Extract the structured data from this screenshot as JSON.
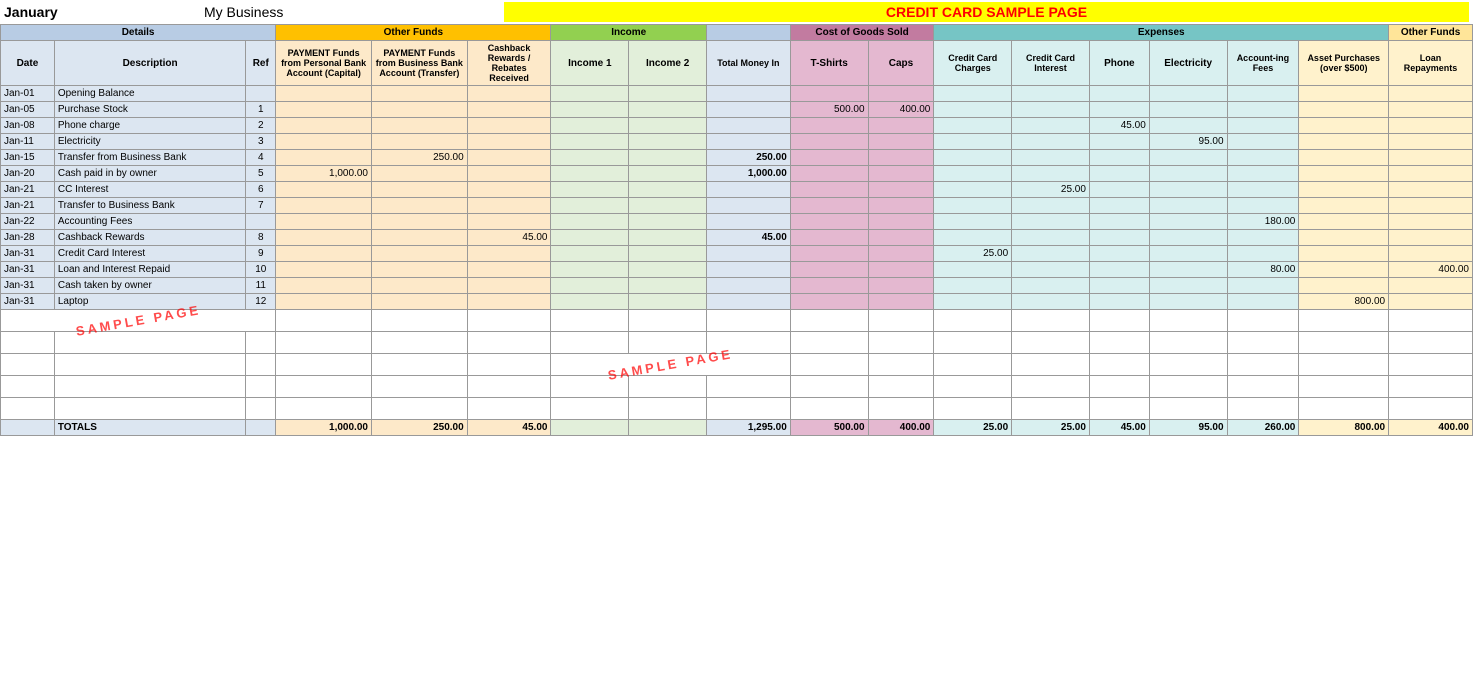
{
  "header": {
    "month": "January",
    "business": "My Business",
    "title": "CREDIT CARD SAMPLE PAGE"
  },
  "columns": {
    "group1_label": "Details",
    "group2_label": "Other Funds",
    "group3_label": "Income",
    "group4_label": "Cost of Goods Sold",
    "group5_label": "Expenses",
    "group6_label": "Other Funds"
  },
  "subheaders": {
    "date": "Date",
    "description": "Description",
    "ref": "Ref",
    "payment_personal": "PAYMENT Funds from Personal Bank Account (Capital)",
    "payment_business": "PAYMENT Funds from Business Bank Account (Transfer)",
    "cashback": "Cashback Rewards / Rebates Received",
    "income1": "Income 1",
    "income2": "Income 2",
    "total_money_in": "Total Money In",
    "tshirts": "T-Shirts",
    "caps": "Caps",
    "credit_card_charges": "Credit Card Charges",
    "credit_card_interest": "Credit Card Interest",
    "phone": "Phone",
    "electricity": "Electricity",
    "accounting_fees": "Account-ing Fees",
    "asset_purchases": "Asset Purchases (over $500)",
    "loan_repayments": "Loan Repayments"
  },
  "rows": [
    {
      "date": "Jan-01",
      "description": "Opening Balance",
      "ref": "",
      "payment_personal": "",
      "payment_business": "",
      "cashback": "",
      "income1": "",
      "income2": "",
      "total_money_in": "",
      "tshirts": "",
      "caps": "",
      "cc_charges": "",
      "cc_interest": "",
      "phone": "",
      "electricity": "",
      "accounting": "",
      "asset": "",
      "loan": ""
    },
    {
      "date": "Jan-05",
      "description": "Purchase Stock",
      "ref": "1",
      "payment_personal": "",
      "payment_business": "",
      "cashback": "",
      "income1": "",
      "income2": "",
      "total_money_in": "",
      "tshirts": "500.00",
      "caps": "400.00",
      "cc_charges": "",
      "cc_interest": "",
      "phone": "",
      "electricity": "",
      "accounting": "",
      "asset": "",
      "loan": ""
    },
    {
      "date": "Jan-08",
      "description": "Phone charge",
      "ref": "2",
      "payment_personal": "",
      "payment_business": "",
      "cashback": "",
      "income1": "",
      "income2": "",
      "total_money_in": "",
      "tshirts": "",
      "caps": "",
      "cc_charges": "",
      "cc_interest": "",
      "phone": "45.00",
      "electricity": "",
      "accounting": "",
      "asset": "",
      "loan": ""
    },
    {
      "date": "Jan-11",
      "description": "Electricity",
      "ref": "3",
      "payment_personal": "",
      "payment_business": "",
      "cashback": "",
      "income1": "",
      "income2": "",
      "total_money_in": "",
      "tshirts": "",
      "caps": "",
      "cc_charges": "",
      "cc_interest": "",
      "phone": "",
      "electricity": "95.00",
      "accounting": "",
      "asset": "",
      "loan": ""
    },
    {
      "date": "Jan-15",
      "description": "Transfer from Business Bank",
      "ref": "4",
      "payment_personal": "",
      "payment_business": "250.00",
      "cashback": "",
      "income1": "",
      "income2": "",
      "total_money_in": "250.00",
      "tshirts": "",
      "caps": "",
      "cc_charges": "",
      "cc_interest": "",
      "phone": "",
      "electricity": "",
      "accounting": "",
      "asset": "",
      "loan": ""
    },
    {
      "date": "Jan-20",
      "description": "Cash paid in by owner",
      "ref": "5",
      "payment_personal": "1,000.00",
      "payment_business": "",
      "cashback": "",
      "income1": "",
      "income2": "",
      "total_money_in": "1,000.00",
      "tshirts": "",
      "caps": "",
      "cc_charges": "",
      "cc_interest": "",
      "phone": "",
      "electricity": "",
      "accounting": "",
      "asset": "",
      "loan": ""
    },
    {
      "date": "Jan-21",
      "description": "CC Interest",
      "ref": "6",
      "payment_personal": "",
      "payment_business": "",
      "cashback": "",
      "income1": "",
      "income2": "",
      "total_money_in": "",
      "tshirts": "",
      "caps": "",
      "cc_charges": "",
      "cc_interest": "25.00",
      "phone": "",
      "electricity": "",
      "accounting": "",
      "asset": "",
      "loan": ""
    },
    {
      "date": "Jan-21",
      "description": "Transfer to Business Bank",
      "ref": "7",
      "payment_personal": "",
      "payment_business": "",
      "cashback": "",
      "income1": "",
      "income2": "",
      "total_money_in": "",
      "tshirts": "",
      "caps": "",
      "cc_charges": "",
      "cc_interest": "",
      "phone": "",
      "electricity": "",
      "accounting": "",
      "asset": "",
      "loan": ""
    },
    {
      "date": "Jan-22",
      "description": "Accounting Fees",
      "ref": "",
      "payment_personal": "",
      "payment_business": "",
      "cashback": "",
      "income1": "",
      "income2": "",
      "total_money_in": "",
      "tshirts": "",
      "caps": "",
      "cc_charges": "",
      "cc_interest": "",
      "phone": "",
      "electricity": "",
      "accounting": "180.00",
      "asset": "",
      "loan": ""
    },
    {
      "date": "Jan-28",
      "description": "Cashback Rewards",
      "ref": "8",
      "payment_personal": "",
      "payment_business": "",
      "cashback": "45.00",
      "income1": "",
      "income2": "",
      "total_money_in": "45.00",
      "tshirts": "",
      "caps": "",
      "cc_charges": "",
      "cc_interest": "",
      "phone": "",
      "electricity": "",
      "accounting": "",
      "asset": "",
      "loan": ""
    },
    {
      "date": "Jan-31",
      "description": "Credit Card Interest",
      "ref": "9",
      "payment_personal": "",
      "payment_business": "",
      "cashback": "",
      "income1": "",
      "income2": "",
      "total_money_in": "",
      "tshirts": "",
      "caps": "",
      "cc_charges": "25.00",
      "cc_interest": "",
      "phone": "",
      "electricity": "",
      "accounting": "",
      "asset": "",
      "loan": ""
    },
    {
      "date": "Jan-31",
      "description": "Loan and Interest Repaid",
      "ref": "10",
      "payment_personal": "",
      "payment_business": "",
      "cashback": "",
      "income1": "",
      "income2": "",
      "total_money_in": "",
      "tshirts": "",
      "caps": "",
      "cc_charges": "",
      "cc_interest": "",
      "phone": "",
      "electricity": "",
      "accounting": "80.00",
      "asset": "",
      "loan": "400.00"
    },
    {
      "date": "Jan-31",
      "description": "Cash taken by owner",
      "ref": "11",
      "payment_personal": "",
      "payment_business": "",
      "cashback": "",
      "income1": "",
      "income2": "",
      "total_money_in": "",
      "tshirts": "",
      "caps": "",
      "cc_charges": "",
      "cc_interest": "",
      "phone": "",
      "electricity": "",
      "accounting": "",
      "asset": "",
      "loan": ""
    },
    {
      "date": "Jan-31",
      "description": "Laptop",
      "ref": "12",
      "payment_personal": "",
      "payment_business": "",
      "cashback": "",
      "income1": "",
      "income2": "",
      "total_money_in": "",
      "tshirts": "",
      "caps": "",
      "cc_charges": "",
      "cc_interest": "",
      "phone": "",
      "electricity": "",
      "accounting": "",
      "asset": "800.00",
      "loan": ""
    }
  ],
  "sample_rows": [
    {
      "has_sample1": true,
      "has_sample2": false
    },
    {
      "has_sample1": false,
      "has_sample2": false
    },
    {
      "has_sample1": false,
      "has_sample2": true
    },
    {
      "has_sample1": false,
      "has_sample2": false
    }
  ],
  "totals": {
    "label": "TOTALS",
    "payment_personal": "1,000.00",
    "payment_business": "250.00",
    "cashback": "45.00",
    "income1": "",
    "income2": "",
    "total_money_in": "1,295.00",
    "tshirts": "500.00",
    "caps": "400.00",
    "cc_charges": "25.00",
    "cc_interest": "25.00",
    "phone": "45.00",
    "electricity": "95.00",
    "accounting": "260.00",
    "asset": "800.00",
    "loan": "400.00"
  }
}
